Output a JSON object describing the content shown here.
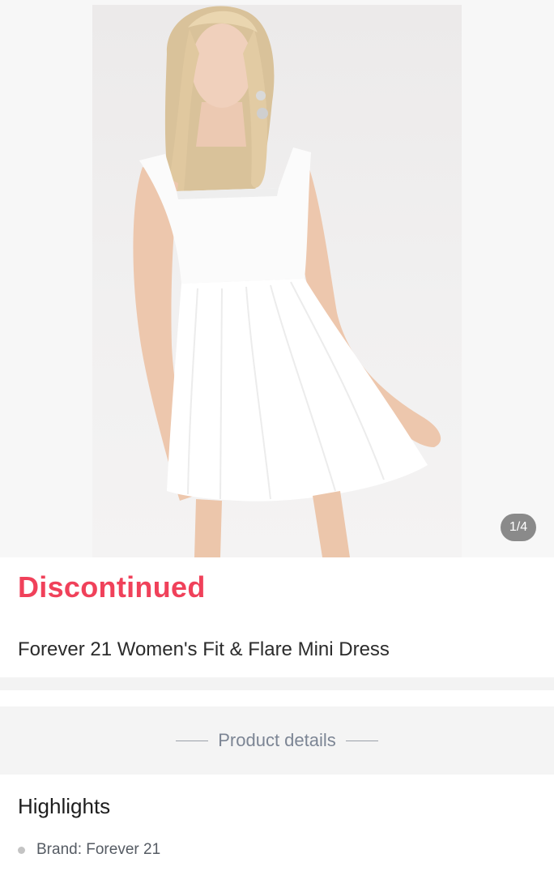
{
  "gallery": {
    "image_label": "woman wearing white fit and flare mini dress",
    "counter": "1/4"
  },
  "product": {
    "status": "Discontinued",
    "name": "Forever 21 Women's Fit & Flare Mini Dress"
  },
  "details": {
    "heading": "Product details"
  },
  "highlights": {
    "title": "Highlights",
    "items": [
      {
        "text": "Brand: Forever 21"
      }
    ]
  },
  "colors": {
    "accent": "#f0415a",
    "background": "#ffffff",
    "section_bg": "#f4f4f4"
  }
}
